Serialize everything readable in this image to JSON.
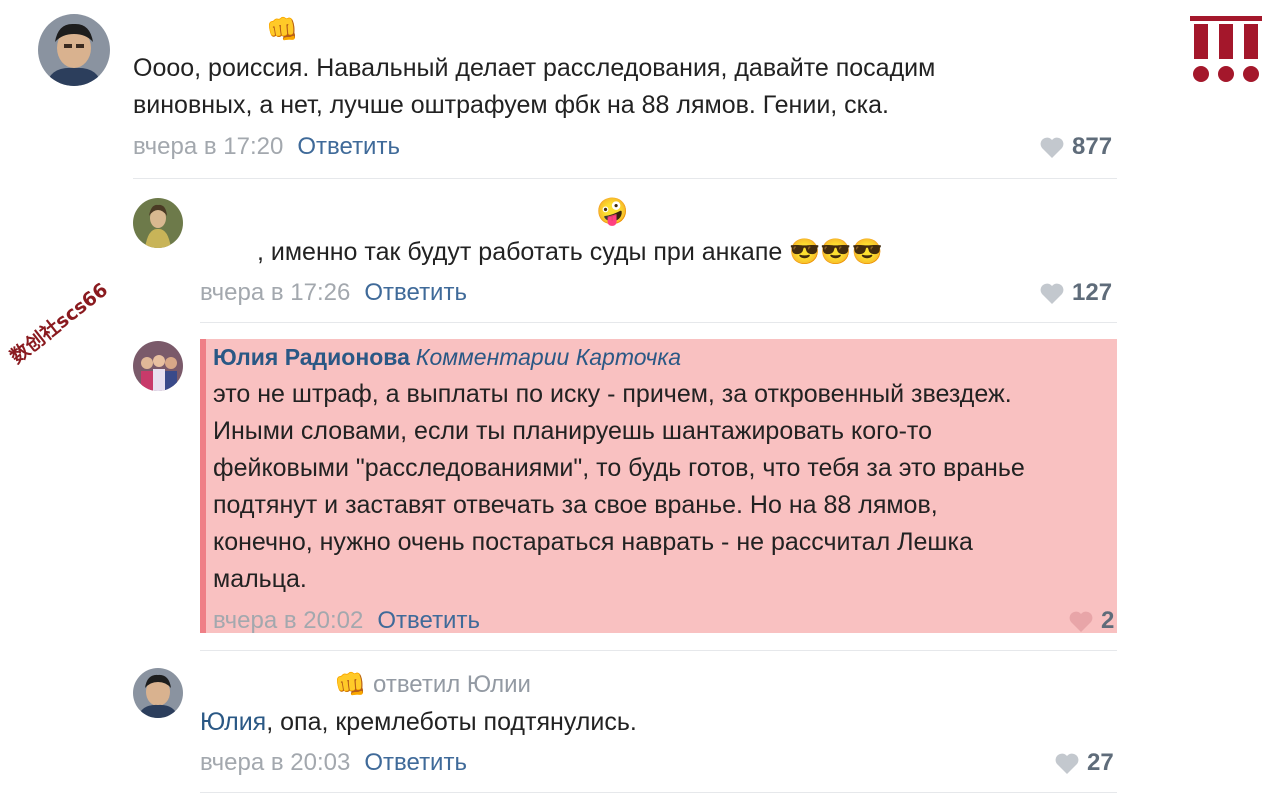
{
  "comments": [
    {
      "text_lines": [
        "Оооо, роиссия. Навальный делает расследования, давайте посадим",
        "виновных, а нет, лучше оштрафуем фбк на 88 лямов. Гении, ска."
      ],
      "time": "вчера в 17:20",
      "reply_label": "Ответить",
      "likes": "877",
      "name_emoji": "👊"
    },
    {
      "text": ", именно так будут работать суды при анкапе 😎😎😎",
      "time": "вчера в 17:26",
      "reply_label": "Ответить",
      "likes": "127",
      "name_emoji": "🤪"
    },
    {
      "author": "Юлия Радионова",
      "group": "Комментарии Карточка",
      "text_lines": [
        "это не штраф, а выплаты по иску - причем, за откровенный звездеж.",
        "Иными словами, если ты планируешь шантажировать кого-то",
        "фейковыми \"расследованиями\", то будь готов, что тебя за это вранье",
        "подтянут и заставят отвечать за свое вранье. Но на 88 лямов,",
        "конечно, нужно очень постараться наврать - не рассчитал Лешка",
        "мальца."
      ],
      "time": "вчера в 20:02",
      "reply_label": "Ответить",
      "likes": "2",
      "highlight_color": "#f9c1c1"
    },
    {
      "name_emoji": "👊",
      "replied_to": "ответил Юлии",
      "mention": "Юлия",
      "text": ", опа, кремлеботы подтянулись.",
      "time": "вчера в 20:03",
      "reply_label": "Ответить",
      "likes": "27"
    }
  ],
  "watermark": "数创社scs66",
  "logo_icon": "exclamation-logo",
  "colors": {
    "link": "#2a5885",
    "meta": "#a3a8ae",
    "logo": "#a4172b",
    "highlight": "#f9c1c1"
  }
}
